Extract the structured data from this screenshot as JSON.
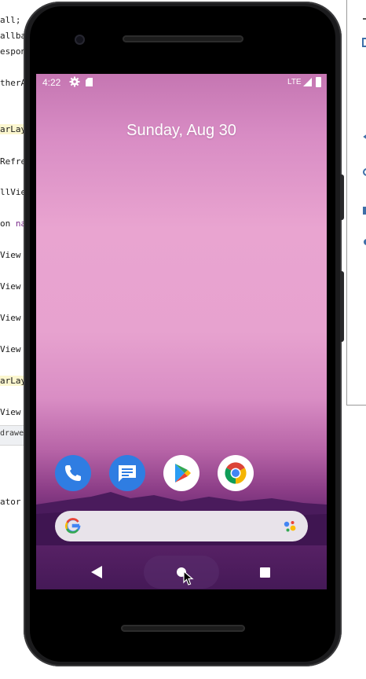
{
  "ide": {
    "lines": [
      "all;",
      "allba",
      "espon",
      "therA",
      "arLayo",
      "Refre",
      "llVie",
      "on ",
      "View",
      "View",
      "View",
      "View",
      "arLay",
      "View",
      "drawer",
      "ator"
    ],
    "keyword_fragment": "na"
  },
  "status_bar": {
    "time": "4:22",
    "network": "LTE",
    "icons": [
      "settings-gear",
      "sd-card",
      "cell-signal",
      "battery"
    ]
  },
  "home": {
    "date": "Sunday, Aug 30"
  },
  "dock": [
    {
      "name": "phone",
      "icon": "phone-icon",
      "color": "#2f7de2"
    },
    {
      "name": "messages",
      "icon": "messages-icon",
      "color": "#2f7de2"
    },
    {
      "name": "play-store",
      "icon": "play-store-icon",
      "color": "#ffffff"
    },
    {
      "name": "chrome",
      "icon": "chrome-icon",
      "color": "#ffffff"
    }
  ],
  "search": {
    "logo": "google-g-icon",
    "assistant": "assistant-mic-icon"
  },
  "navigation": [
    "back",
    "home",
    "recents"
  ],
  "colors": {
    "wallpaper_top": "#c576b2",
    "wallpaper_mid": "#e9a4d0",
    "wallpaper_bottom": "#451957",
    "accent_blue": "#2f7de2"
  }
}
